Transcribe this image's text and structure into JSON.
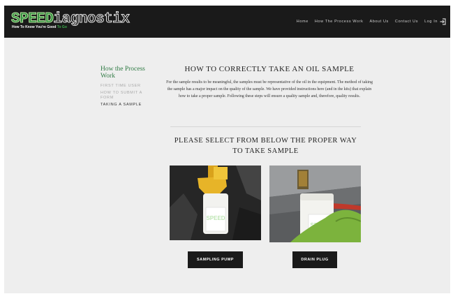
{
  "header": {
    "logo_speed": "SPEED",
    "logo_rest": "iagnostix",
    "tagline_white": "How To Know You're Good",
    "tagline_green": "To Go"
  },
  "nav": {
    "items": [
      "Home",
      "How The Process Work",
      "About Us",
      "Contact Us"
    ],
    "login_label": "Log In"
  },
  "sidebar": {
    "title": "How the Process Work",
    "links": [
      "FIRST TIME USER",
      "HOW TO SUBMIT A FORM",
      "TAKING A SAMPLE"
    ],
    "active_index": 2
  },
  "main": {
    "title": "HOW TO CORRECTLY TAKE AN OIL SAMPLE",
    "intro": "For the sample results to be meaningful, the samples must be representative of the oil in the equipment. The method of taking the sample has a major impact on the quality of the sample. We have provided instructions here (and in the kits) that explain how to take a proper sample. Following these steps will ensure a quality sample and, therefore, quality results.",
    "select_title": "PLEASE SELECT FROM BELOW THE PROPER WAY TO TAKE SAMPLE",
    "bottle_label": "SPEED",
    "buttons": [
      "SAMPLING PUMP",
      "DRAIN PLUG"
    ]
  },
  "colors": {
    "header_bg": "#1a1a1a",
    "accent_green": "#2f7a44",
    "page_bg": "#eeeeee",
    "button_bg": "#1a1a1a"
  }
}
